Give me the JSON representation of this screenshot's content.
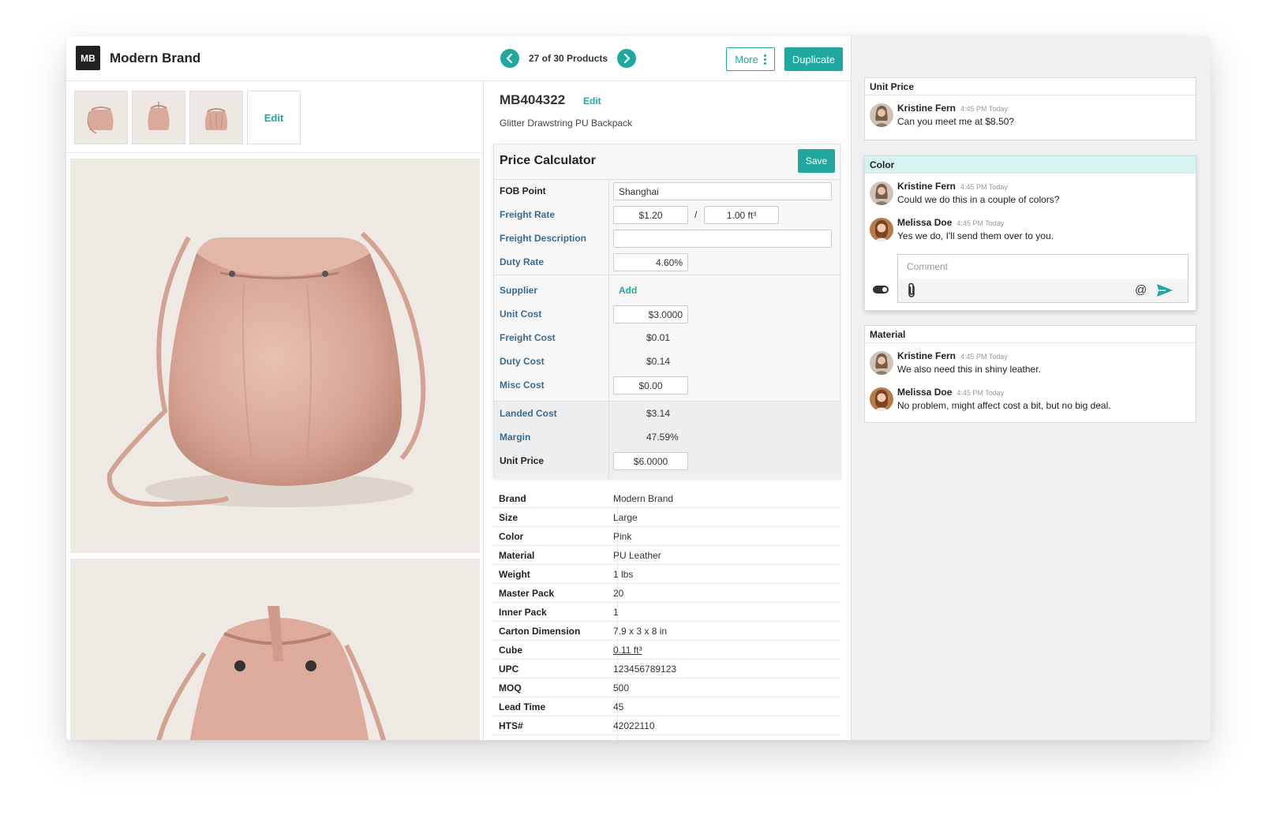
{
  "header": {
    "logo": "MB",
    "brand": "Modern Brand",
    "pager_text": "27 of 30 Products",
    "more_label": "More",
    "duplicate_label": "Duplicate"
  },
  "images": {
    "edit_label": "Edit"
  },
  "product": {
    "sku": "MB404322",
    "sku_edit": "Edit",
    "name": "Glitter Drawstring PU Backpack"
  },
  "calculator": {
    "title": "Price Calculator",
    "save_label": "Save",
    "fob_label": "FOB Point",
    "fob_value": "Shanghai",
    "freight_rate_label": "Freight Rate",
    "freight_rate_value": "$1.20",
    "freight_rate_sep": "/",
    "freight_rate_unit": "1.00 ft³",
    "freight_desc_label": "Freight Description",
    "freight_desc_value": "",
    "duty_rate_label": "Duty Rate",
    "duty_rate_value": "4.60%",
    "supplier_label": "Supplier",
    "supplier_add": "Add",
    "unit_cost_label": "Unit Cost",
    "unit_cost_value": "$3.0000",
    "freight_cost_label": "Freight Cost",
    "freight_cost_value": "$0.01",
    "duty_cost_label": "Duty Cost",
    "duty_cost_value": "$0.14",
    "misc_cost_label": "Misc Cost",
    "misc_cost_value": "$0.00",
    "landed_cost_label": "Landed Cost",
    "landed_cost_value": "$3.14",
    "margin_label": "Margin",
    "margin_value": "47.59%",
    "unit_price_label": "Unit Price",
    "unit_price_value": "$6.0000"
  },
  "specs": [
    {
      "label": "Brand",
      "value": "Modern Brand"
    },
    {
      "label": "Size",
      "value": "Large"
    },
    {
      "label": "Color",
      "value": "Pink"
    },
    {
      "label": "Material",
      "value": "PU Leather"
    },
    {
      "label": "Weight",
      "value": "1 lbs"
    },
    {
      "label": "Master Pack",
      "value": "20"
    },
    {
      "label": "Inner Pack",
      "value": "1"
    },
    {
      "label": "Carton Dimension",
      "value": " 7.9 x 3 x 8 in"
    },
    {
      "label": "Cube",
      "value": " 0.11 ft³"
    },
    {
      "label": "UPC",
      "value": "123456789123"
    },
    {
      "label": "MOQ",
      "value": "500"
    },
    {
      "label": "Lead Time",
      "value": "45"
    },
    {
      "label": "HTS#",
      "value": "42022110"
    }
  ],
  "threads": {
    "unit_price": {
      "title": "Unit Price",
      "comments": [
        {
          "author": "Kristine Fern",
          "time": "4:45 PM Today",
          "text": "Can you meet me at $8.50?"
        }
      ]
    },
    "color": {
      "title": "Color",
      "comments": [
        {
          "author": "Kristine Fern",
          "time": "4:45 PM Today",
          "text": "Could we do this in a couple of colors?"
        },
        {
          "author": "Melissa Doe",
          "time": "4:45 PM Today",
          "text": "Yes we do, I'll send them over to you."
        }
      ],
      "comment_placeholder": "Comment",
      "mention_symbol": "@"
    },
    "material": {
      "title": "Material",
      "comments": [
        {
          "author": "Kristine Fern",
          "time": "4:45 PM Today",
          "text": "We also need this in shiny leather."
        },
        {
          "author": "Melissa Doe",
          "time": "4:45 PM Today",
          "text": "No problem, might affect cost a bit, but no big deal."
        }
      ]
    }
  },
  "colors": {
    "accent": "#1fa8a0",
    "label_blue": "#3d6b8f",
    "active_thread": "#d6f3f1"
  }
}
